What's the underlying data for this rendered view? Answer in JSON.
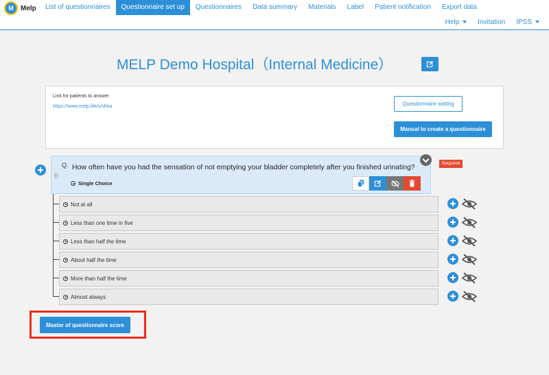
{
  "app": {
    "logo_text": "Melp",
    "logo_glyph": "M"
  },
  "nav": {
    "items": [
      {
        "label": "List of questionnaires",
        "active": false
      },
      {
        "label": "Questionnaire set up",
        "active": true
      },
      {
        "label": "Questionnaires",
        "active": false
      },
      {
        "label": "Data summary",
        "active": false
      },
      {
        "label": "Materials",
        "active": false
      },
      {
        "label": "Label",
        "active": false
      },
      {
        "label": "Patient notification",
        "active": false
      },
      {
        "label": "Export data",
        "active": false
      }
    ]
  },
  "subnav": {
    "help": "Help",
    "invitation": "Invitation",
    "ipss": "IPSS"
  },
  "header": {
    "title": "MELP Demo Hospital（Internal Medicine）"
  },
  "link_panel": {
    "label": "Link for patients to answer",
    "url": "https://www.melp.life/s/sfrka",
    "setting_button": "Questionnaire setting",
    "manual_button": "Manual to create a questionnaire"
  },
  "question": {
    "prefix": "Q.",
    "text": "How often have you had the sensation of not emptying your bladder completely after you finished urinating?",
    "required_badge": "Required",
    "type_label": "Single Choice",
    "options": [
      {
        "label": "Not at all"
      },
      {
        "label": "Less than one time in five"
      },
      {
        "label": "Less than half the time"
      },
      {
        "label": "About half the time"
      },
      {
        "label": "More than half the time"
      },
      {
        "label": "Almost always"
      }
    ]
  },
  "footer": {
    "score_button": "Master of questionnaire score"
  },
  "colors": {
    "accent": "#2d8fd8",
    "danger": "#e34a30",
    "highlight": "#ee2a1c"
  }
}
